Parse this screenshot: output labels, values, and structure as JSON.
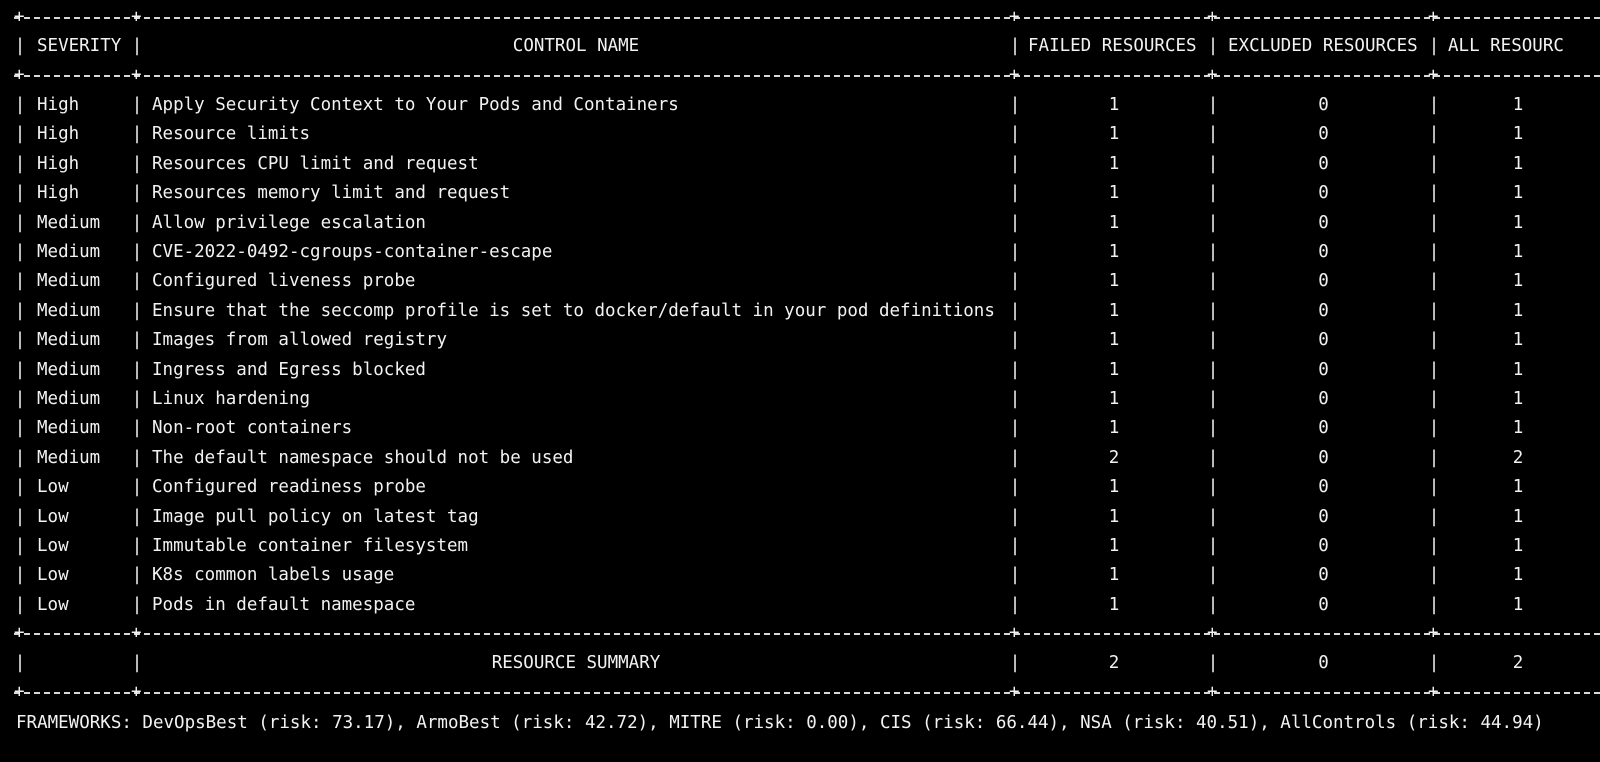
{
  "columns": {
    "severity": "SEVERITY",
    "control_name": "CONTROL NAME",
    "failed_resources": "FAILED RESOURCES",
    "excluded_resources": "EXCLUDED RESOURCES",
    "all_resources": "ALL RESOURC"
  },
  "rows": [
    {
      "severity": "High",
      "control": "Apply Security Context to Your Pods and Containers",
      "failed": "1",
      "excluded": "0",
      "all": "1"
    },
    {
      "severity": "High",
      "control": "Resource limits",
      "failed": "1",
      "excluded": "0",
      "all": "1"
    },
    {
      "severity": "High",
      "control": "Resources CPU limit and request",
      "failed": "1",
      "excluded": "0",
      "all": "1"
    },
    {
      "severity": "High",
      "control": "Resources memory limit and request",
      "failed": "1",
      "excluded": "0",
      "all": "1"
    },
    {
      "severity": "Medium",
      "control": "Allow privilege escalation",
      "failed": "1",
      "excluded": "0",
      "all": "1"
    },
    {
      "severity": "Medium",
      "control": "CVE-2022-0492-cgroups-container-escape",
      "failed": "1",
      "excluded": "0",
      "all": "1"
    },
    {
      "severity": "Medium",
      "control": "Configured liveness probe",
      "failed": "1",
      "excluded": "0",
      "all": "1"
    },
    {
      "severity": "Medium",
      "control": "Ensure that the seccomp profile is set to docker/default in your pod definitions",
      "failed": "1",
      "excluded": "0",
      "all": "1"
    },
    {
      "severity": "Medium",
      "control": "Images from allowed registry",
      "failed": "1",
      "excluded": "0",
      "all": "1"
    },
    {
      "severity": "Medium",
      "control": "Ingress and Egress blocked",
      "failed": "1",
      "excluded": "0",
      "all": "1"
    },
    {
      "severity": "Medium",
      "control": "Linux hardening",
      "failed": "1",
      "excluded": "0",
      "all": "1"
    },
    {
      "severity": "Medium",
      "control": "Non-root containers",
      "failed": "1",
      "excluded": "0",
      "all": "1"
    },
    {
      "severity": "Medium",
      "control": "The default namespace should not be used",
      "failed": "2",
      "excluded": "0",
      "all": "2"
    },
    {
      "severity": "Low",
      "control": "Configured readiness probe",
      "failed": "1",
      "excluded": "0",
      "all": "1"
    },
    {
      "severity": "Low",
      "control": "Image pull policy on latest tag",
      "failed": "1",
      "excluded": "0",
      "all": "1"
    },
    {
      "severity": "Low",
      "control": "Immutable container filesystem",
      "failed": "1",
      "excluded": "0",
      "all": "1"
    },
    {
      "severity": "Low",
      "control": "K8s common labels usage",
      "failed": "1",
      "excluded": "0",
      "all": "1"
    },
    {
      "severity": "Low",
      "control": "Pods in default namespace",
      "failed": "1",
      "excluded": "0",
      "all": "1"
    }
  ],
  "summary": {
    "label": "RESOURCE SUMMARY",
    "failed": "2",
    "excluded": "0",
    "all": "2"
  },
  "frameworks_line": "FRAMEWORKS: DevOpsBest (risk: 73.17), ArmoBest (risk: 42.72), MITRE (risk: 0.00), CIS (risk: 66.44), NSA (risk: 40.51), AllControls (risk: 44.94)"
}
